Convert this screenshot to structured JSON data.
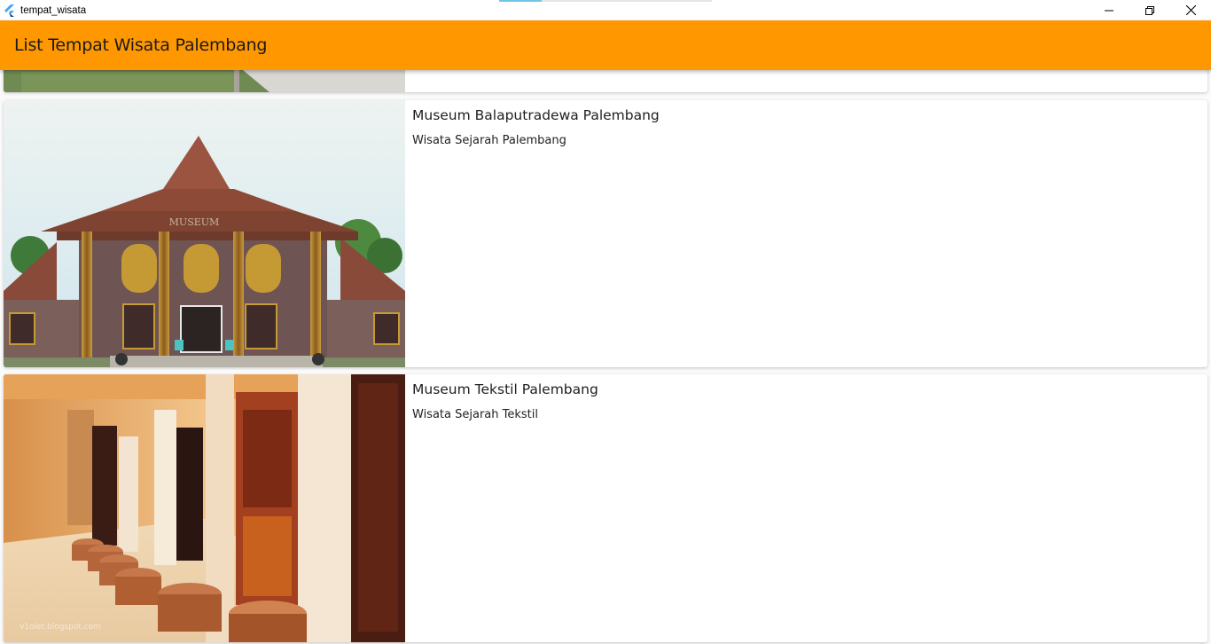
{
  "window": {
    "title": "tempat_wisata",
    "app_icon": "flutter-icon"
  },
  "appbar": {
    "title": "List Tempat Wisata Palembang",
    "color": "#ff9800"
  },
  "places": [
    {
      "name": "",
      "category": "",
      "image": "park-photo"
    },
    {
      "name": "Museum Balaputradewa Palembang",
      "category": "Wisata Sejarah Palembang",
      "image": "museum-building-photo"
    },
    {
      "name": "Museum Tekstil Palembang",
      "category": "Wisata Sejarah Tekstil",
      "image": "textile-gallery-photo",
      "watermark": "v1olet.blogspot.com"
    }
  ]
}
